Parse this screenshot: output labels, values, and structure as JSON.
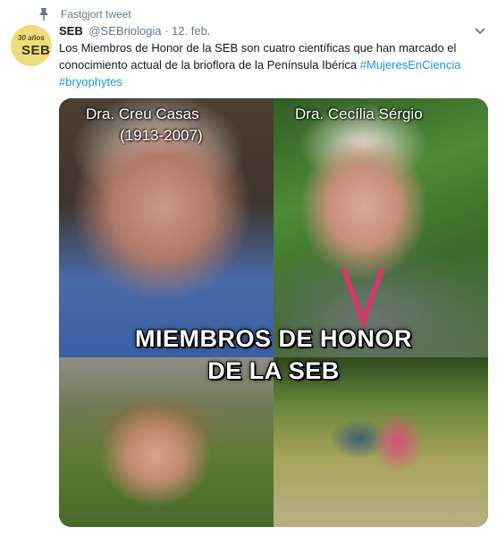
{
  "pinned": {
    "label": "Fastgjort tweet",
    "icon": "pin-icon"
  },
  "tweet": {
    "name": "SEB",
    "handle": "@SEBriologia",
    "separator": " · ",
    "date": "12. feb.",
    "text_main": "Los Miembros de Honor de la SEB son cuatro científicas que han marcado el conocimiento actual de la brioflora de la Península Ibérica ",
    "hashtag1": "#MujeresEnCiencia",
    "hashtag2": "#bryophytes",
    "menu_icon": "chevron-down-icon"
  },
  "avatar": {
    "line1": "30 años",
    "line2": "SEB",
    "bg": "#efdc7e"
  },
  "media": {
    "caption_top_left_1": "Dra. Creu Casas",
    "caption_top_left_2": "(1913-2007)",
    "caption_top_right": "Dra. Cecília Sérgio",
    "overlay_line1": "MIEMBROS DE HONOR",
    "overlay_line2": "DE LA SEB"
  },
  "colors": {
    "link": "#1b95e0",
    "text": "#14171a",
    "muted": "#657786"
  }
}
